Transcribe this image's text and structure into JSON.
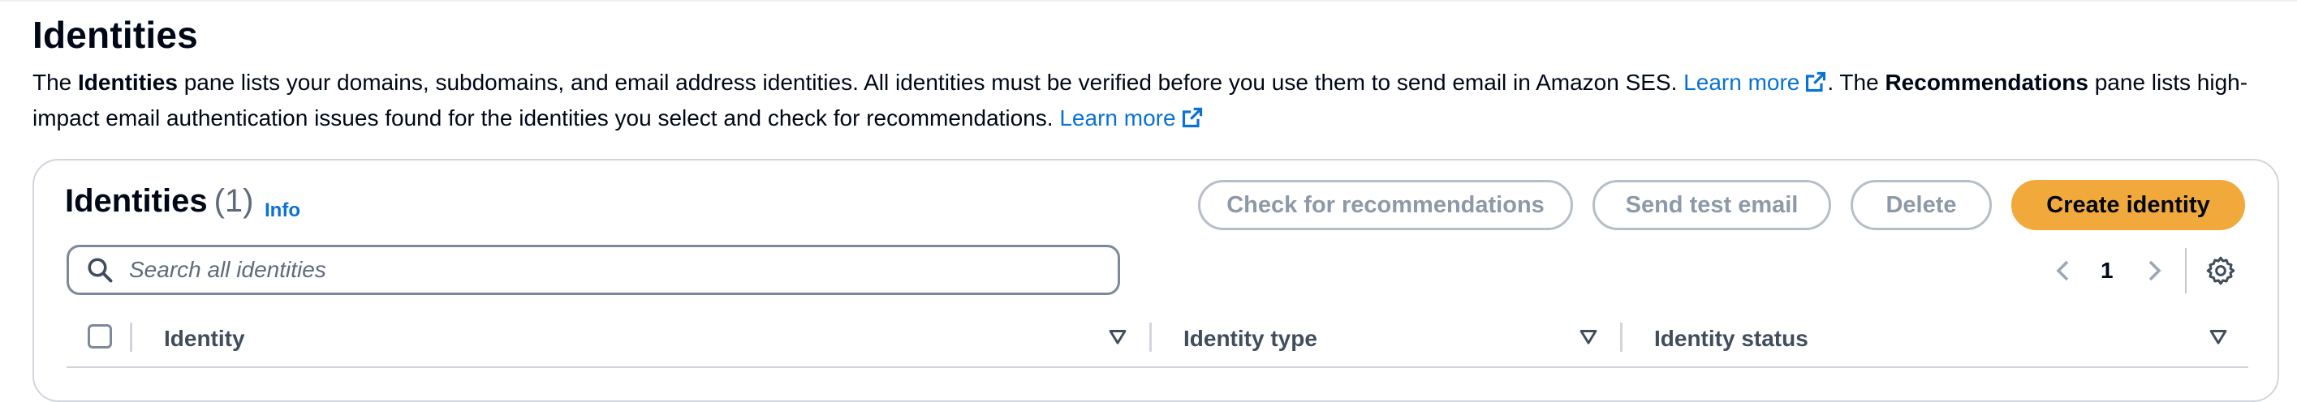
{
  "page": {
    "title": "Identities",
    "description": {
      "part1": "The ",
      "bold1": "Identities",
      "part2": " pane lists your domains, subdomains, and email address identities. All identities must be verified before you use them to send email in Amazon SES. ",
      "link1": "Learn more",
      "part3": ". The ",
      "bold2": "Recommendations",
      "part4": " pane lists high-impact email authentication issues found for the identities you select and check for recommendations. ",
      "link2": "Learn more"
    }
  },
  "panel": {
    "title": "Identities",
    "count": "(1)",
    "info_link": "Info",
    "buttons": {
      "check": "Check for recommendations",
      "send_test": "Send test email",
      "delete": "Delete",
      "create": "Create identity"
    },
    "search": {
      "placeholder": "Search all identities",
      "icon": "search-icon"
    },
    "pagination": {
      "current_page": "1",
      "prev_icon": "chevron-left-icon",
      "next_icon": "chevron-right-icon"
    },
    "settings_icon": "gear-icon",
    "table": {
      "columns": [
        "Identity",
        "Identity type",
        "Identity status"
      ]
    }
  },
  "colors": {
    "primary_button": "#f2a93b",
    "link": "#0972d3",
    "disabled_text": "#8d99a8"
  }
}
